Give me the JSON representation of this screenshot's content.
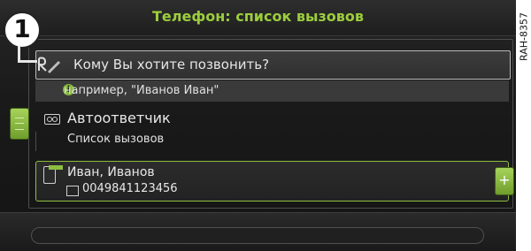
{
  "header": {
    "title": "Телефон: список вызовов"
  },
  "search": {
    "prompt": "Кому Вы хотите позвонить?",
    "hint": "например, \"Иванов Иван\""
  },
  "menu": {
    "answering_machine": "Автоответчик",
    "call_list": "Список вызовов"
  },
  "contact": {
    "name": "Иван, Иванов",
    "number": "0049841123456"
  },
  "callout": {
    "number": "1"
  },
  "figure_code": "RAH-8357",
  "colors": {
    "accent": "#9ccd3d",
    "frame_green": "#8cbf40",
    "background": "#1a1a1a"
  },
  "icons": [
    "edit-pen-icon",
    "info-icon",
    "answering-machine-icon",
    "phone-incoming-icon",
    "handset-icon",
    "menu-lines-icon",
    "plus-icon"
  ]
}
